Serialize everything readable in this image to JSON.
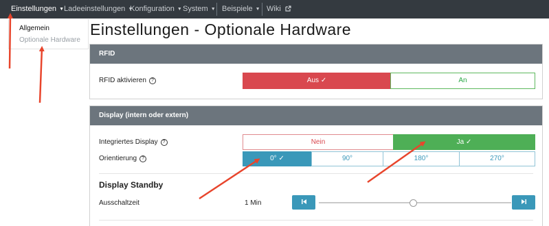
{
  "navbar": {
    "items": [
      {
        "label": "Einstellungen"
      },
      {
        "label": "Ladeeinstellungen"
      },
      {
        "label": "Konfiguration"
      },
      {
        "label": "System"
      },
      {
        "label": "Beispiele"
      },
      {
        "label": "Wiki"
      }
    ]
  },
  "dropdown": {
    "items": [
      {
        "label": "Allgemein"
      },
      {
        "label": "Optionale Hardware"
      }
    ]
  },
  "page": {
    "title": "Einstellungen - Optionale Hardware"
  },
  "rfid": {
    "header": "RFID",
    "label": "RFID aktivieren",
    "options": [
      "Aus",
      "An"
    ],
    "selected": "Aus"
  },
  "display": {
    "header": "Display (intern oder extern)",
    "integrated_label": "Integriertes Display",
    "integrated_options": [
      "Nein",
      "Ja"
    ],
    "integrated_selected": "Ja",
    "orientation_label": "Orientierung",
    "orientation_options": [
      "0°",
      "90°",
      "180°",
      "270°"
    ],
    "orientation_selected": "0°",
    "standby_title": "Display Standby",
    "shutoff_label": "Ausschaltzeit",
    "shutoff_value": "1 Min",
    "shutoff_slider_fraction": 0.49
  },
  "colors": {
    "navbar": "#343a40",
    "card_header": "#6c757d",
    "danger": "#d9484f",
    "success": "#4eaf56",
    "info": "#3a98b9",
    "annotation_arrow": "#e8452c"
  }
}
